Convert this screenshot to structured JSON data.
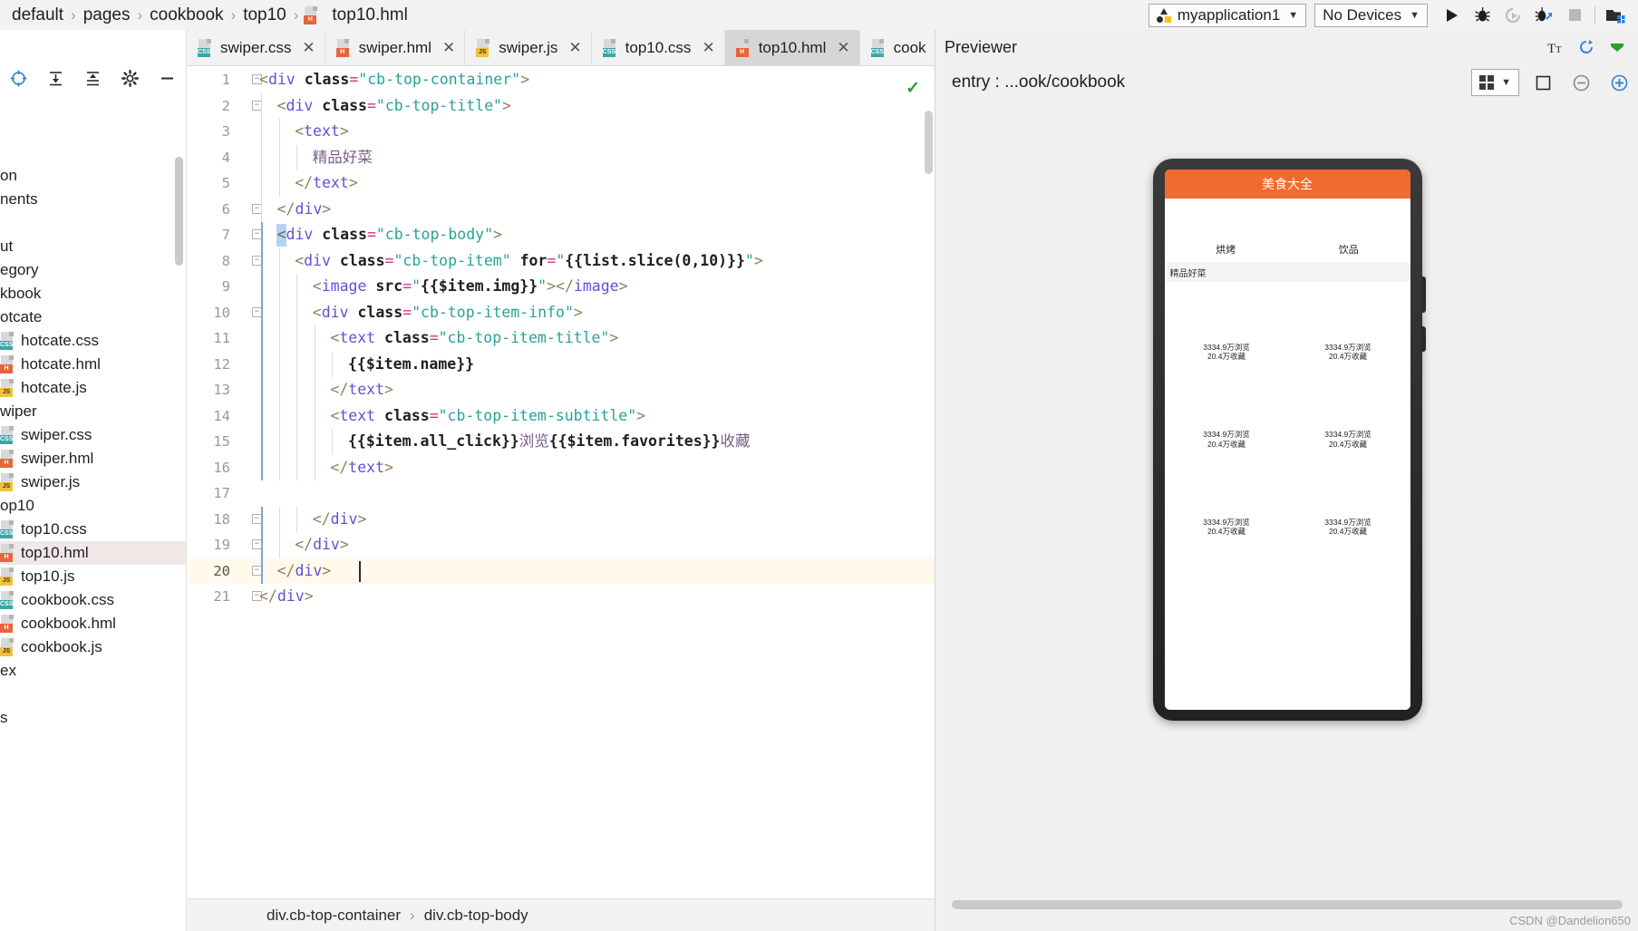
{
  "breadcrumb": {
    "items": [
      "default",
      "pages",
      "cookbook",
      "top10"
    ],
    "separator": "›",
    "file": "top10.hml"
  },
  "toolbar": {
    "app_selector": "myapplication1",
    "device_selector": "No Devices",
    "caret": "▼",
    "run_title": "Run",
    "debug_title": "Debug",
    "rerun_title": "Rerun",
    "profile_title": "Profiler",
    "stop_title": "Stop",
    "devices_title": "Device Manager"
  },
  "project_tree": {
    "rows": [
      {
        "label": "on",
        "icon": "none",
        "selected": false
      },
      {
        "label": "nents",
        "icon": "none",
        "selected": false
      },
      {
        "label": "",
        "icon": "none",
        "selected": false
      },
      {
        "label": "ut",
        "icon": "none",
        "selected": false
      },
      {
        "label": "egory",
        "icon": "none",
        "selected": false
      },
      {
        "label": "kbook",
        "icon": "none",
        "selected": false
      },
      {
        "label": "otcate",
        "icon": "none",
        "selected": false
      },
      {
        "label": "hotcate.css",
        "icon": "css",
        "selected": false
      },
      {
        "label": "hotcate.hml",
        "icon": "html",
        "selected": false
      },
      {
        "label": "hotcate.js",
        "icon": "js",
        "selected": false
      },
      {
        "label": "wiper",
        "icon": "none",
        "selected": false
      },
      {
        "label": "swiper.css",
        "icon": "css",
        "selected": false
      },
      {
        "label": "swiper.hml",
        "icon": "html",
        "selected": false
      },
      {
        "label": "swiper.js",
        "icon": "js",
        "selected": false
      },
      {
        "label": "op10",
        "icon": "none",
        "selected": false
      },
      {
        "label": "top10.css",
        "icon": "css",
        "selected": false
      },
      {
        "label": "top10.hml",
        "icon": "html",
        "selected": true
      },
      {
        "label": "top10.js",
        "icon": "js",
        "selected": false
      },
      {
        "label": "cookbook.css",
        "icon": "css",
        "selected": false
      },
      {
        "label": "cookbook.hml",
        "icon": "html",
        "selected": false
      },
      {
        "label": "cookbook.js",
        "icon": "js",
        "selected": false
      },
      {
        "label": "ex",
        "icon": "none",
        "selected": false
      },
      {
        "label": "",
        "icon": "none",
        "selected": false
      },
      {
        "label": "s",
        "icon": "none",
        "selected": false
      }
    ]
  },
  "editor": {
    "tabs": [
      {
        "label": "swiper.css",
        "icon": "css",
        "active": false,
        "closable": true
      },
      {
        "label": "swiper.hml",
        "icon": "html",
        "active": false,
        "closable": true
      },
      {
        "label": "swiper.js",
        "icon": "js",
        "active": false,
        "closable": true
      },
      {
        "label": "top10.css",
        "icon": "css",
        "active": false,
        "closable": true
      },
      {
        "label": "top10.hml",
        "icon": "html",
        "active": true,
        "closable": true
      },
      {
        "label": "cook",
        "icon": "css",
        "active": false,
        "closable": false
      }
    ],
    "tabs_overflow": "⌄",
    "status_ok": "✓",
    "current_line": 20,
    "lines": [
      {
        "n": 1,
        "indent": 0,
        "fold": "minus",
        "text": "<div class=\"cb-top-container\">"
      },
      {
        "n": 2,
        "indent": 1,
        "fold": "minus",
        "text": "<div class=\"cb-top-title\">"
      },
      {
        "n": 3,
        "indent": 2,
        "fold": "",
        "text": "<text>"
      },
      {
        "n": 4,
        "indent": 3,
        "fold": "",
        "text": "精品好菜"
      },
      {
        "n": 5,
        "indent": 2,
        "fold": "",
        "text": "</text>"
      },
      {
        "n": 6,
        "indent": 1,
        "fold": "minus",
        "text": "</div>"
      },
      {
        "n": 7,
        "indent": 1,
        "fold": "minus",
        "text": "<div class=\"cb-top-body\">"
      },
      {
        "n": 8,
        "indent": 2,
        "fold": "minus",
        "text": "<div class=\"cb-top-item\" for=\"{{list.slice(0,10)}}\">"
      },
      {
        "n": 9,
        "indent": 3,
        "fold": "",
        "text": "<image src=\"{{$item.img}}\"></image>"
      },
      {
        "n": 10,
        "indent": 3,
        "fold": "minus",
        "text": "<div class=\"cb-top-item-info\">"
      },
      {
        "n": 11,
        "indent": 4,
        "fold": "",
        "text": "<text class=\"cb-top-item-title\">"
      },
      {
        "n": 12,
        "indent": 5,
        "fold": "",
        "text": "{{$item.name}}"
      },
      {
        "n": 13,
        "indent": 4,
        "fold": "",
        "text": "</text>"
      },
      {
        "n": 14,
        "indent": 4,
        "fold": "",
        "text": "<text class=\"cb-top-item-subtitle\">"
      },
      {
        "n": 15,
        "indent": 5,
        "fold": "",
        "text": "{{$item.all_click}}浏览{{$item.favorites}}收藏"
      },
      {
        "n": 16,
        "indent": 4,
        "fold": "",
        "text": "</text>"
      },
      {
        "n": 17,
        "indent": 0,
        "fold": "",
        "text": ""
      },
      {
        "n": 18,
        "indent": 3,
        "fold": "minus",
        "text": "</div>"
      },
      {
        "n": 19,
        "indent": 2,
        "fold": "minus",
        "text": "</div>"
      },
      {
        "n": 20,
        "indent": 1,
        "fold": "minus",
        "text": "</div>"
      },
      {
        "n": 21,
        "indent": 0,
        "fold": "minus",
        "text": "</div>"
      }
    ],
    "status_breadcrumb": [
      "div.cb-top-container",
      "div.cb-top-body"
    ],
    "status_sep": "›"
  },
  "previewer": {
    "title": "Previewer",
    "entry_label": "entry : ...ook/cookbook",
    "tools": {
      "font_title": "Font size",
      "refresh_title": "Refresh",
      "more_title": "More",
      "frame_title": "Show frame",
      "zoom_out": "⊖",
      "zoom_in": "⊕",
      "layout_caret": "▼"
    },
    "phone": {
      "app_title": "美食大全",
      "categories": [
        {
          "name": "烘烤"
        },
        {
          "name": "饮品"
        }
      ],
      "section_title": "精品好菜",
      "cards": [
        {
          "title": "3334.9万浏览",
          "subtitle": "20.4万收藏"
        },
        {
          "title": "3334.9万浏览",
          "subtitle": "20.4万收藏"
        },
        {
          "title": "3334.9万浏览",
          "subtitle": "20.4万收藏"
        },
        {
          "title": "3334.9万浏览",
          "subtitle": "20.4万收藏"
        },
        {
          "title": "3334.9万浏览",
          "subtitle": "20.4万收藏"
        },
        {
          "title": "3334.9万浏览",
          "subtitle": "20.4万收藏"
        },
        {
          "title": "",
          "subtitle": ""
        },
        {
          "title": "",
          "subtitle": ""
        }
      ]
    }
  },
  "watermark": "CSDN @Dandelion650",
  "colors": {
    "accent_orange": "#ef6b2e",
    "tab_active": "#d6d6d6",
    "current_line": "#fffaec",
    "selection": "#a8cdf0",
    "ok_green": "#2aa02a"
  }
}
